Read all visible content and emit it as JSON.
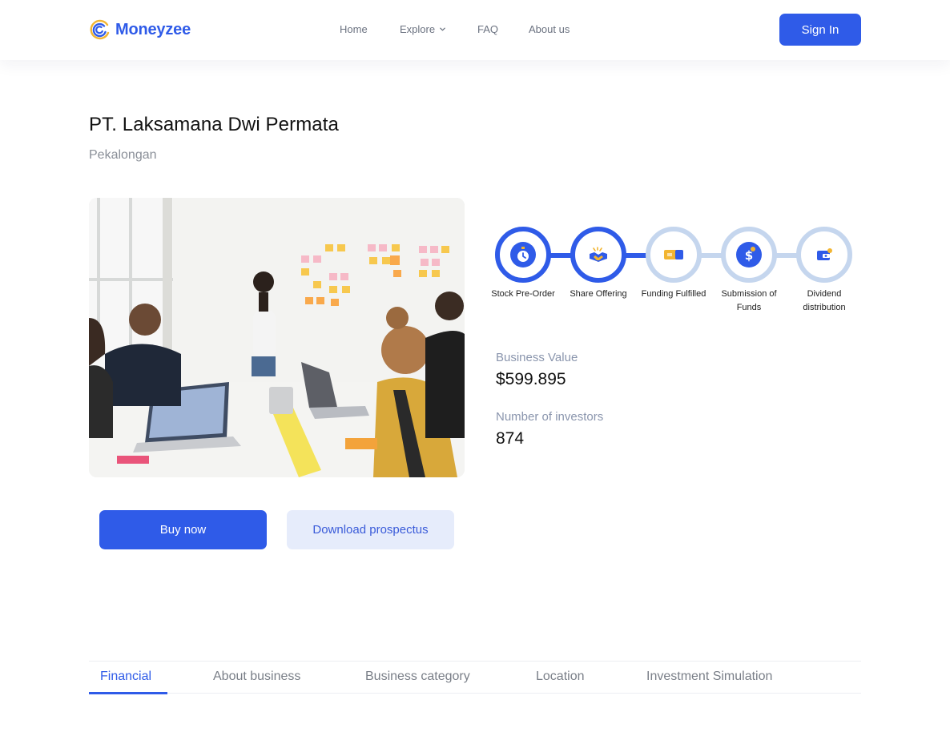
{
  "brand": {
    "name": "Moneyzee",
    "accent": "#2f5be8"
  },
  "nav": {
    "items": [
      {
        "label": "Home"
      },
      {
        "label": "Explore",
        "has_dropdown": true
      },
      {
        "label": "FAQ"
      },
      {
        "label": "About us"
      }
    ],
    "sign_in": "Sign In"
  },
  "company": {
    "name": "PT. Laksamana Dwi Permata",
    "location": "Pekalongan"
  },
  "steps": [
    {
      "label": "Stock Pre-Order",
      "icon": "stopwatch-icon",
      "status": "done"
    },
    {
      "label": "Share Offering",
      "icon": "handshake-icon",
      "status": "done"
    },
    {
      "label": "Funding Fulfilled",
      "icon": "money-bill-icon",
      "status": "pending"
    },
    {
      "label": "Submission of Funds",
      "icon": "dollar-coin-icon",
      "status": "pending"
    },
    {
      "label": "Dividend distribution",
      "icon": "wallet-icon",
      "status": "pending"
    }
  ],
  "stats": {
    "business_value_label": "Business Value",
    "business_value": "$599.895",
    "investors_label": "Number of investors",
    "investors": "874"
  },
  "actions": {
    "buy": "Buy now",
    "download": "Download prospectus"
  },
  "tabs": [
    {
      "label": "Financial",
      "active": true
    },
    {
      "label": "About business",
      "active": false
    },
    {
      "label": "Business category",
      "active": false
    },
    {
      "label": "Location",
      "active": false
    },
    {
      "label": "Investment Simulation",
      "active": false
    }
  ]
}
